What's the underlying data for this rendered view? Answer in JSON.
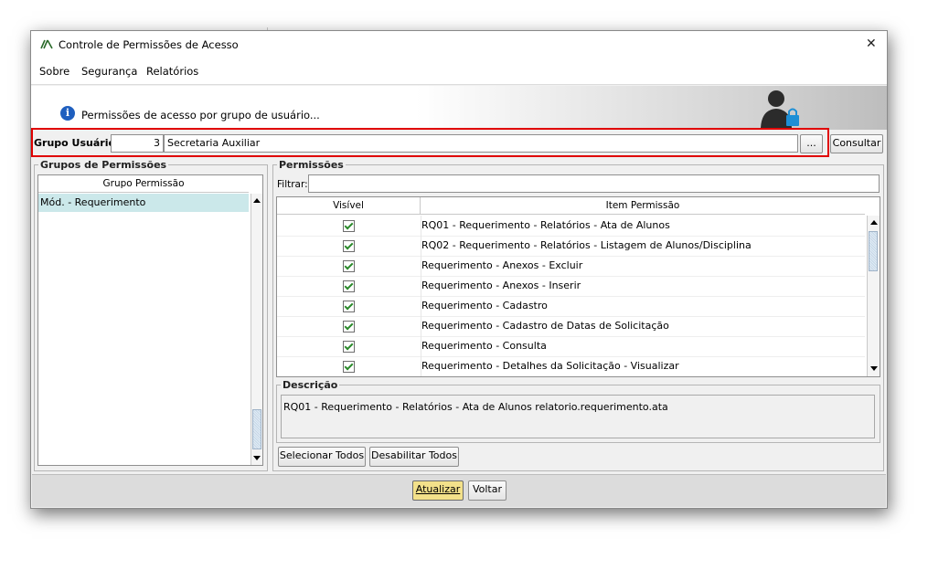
{
  "window": {
    "title": "Controle de Permissões de Acesso",
    "close_label": "✕"
  },
  "menu": {
    "items": [
      "Sobre",
      "Segurança",
      "Relatórios"
    ]
  },
  "header": {
    "info_text": "Permissões de acesso por grupo de usuário..."
  },
  "grupo_usuario": {
    "label": "Grupo Usuário:",
    "code": "3",
    "name": "Secretaria Auxiliar",
    "browse_label": "...",
    "consultar_label": "Consultar",
    "highlight_color": "#e00000"
  },
  "grupos": {
    "legend": "Grupos de Permissões",
    "column_header": "Grupo Permissão",
    "items": [
      "Mód. - Requerimento"
    ],
    "selected_color": "#cbe8ea"
  },
  "permissoes": {
    "legend": "Permissões",
    "filter_label": "Filtrar:",
    "filter_value": "",
    "columns": [
      "Visível",
      "Item Permissão"
    ],
    "rows": [
      {
        "visible": true,
        "item": "RQ01 - Requerimento - Relatórios - Ata de Alunos"
      },
      {
        "visible": true,
        "item": "RQ02 - Requerimento - Relatórios - Listagem de Alunos/Disciplina"
      },
      {
        "visible": true,
        "item": "Requerimento - Anexos - Excluir"
      },
      {
        "visible": true,
        "item": "Requerimento - Anexos - Inserir"
      },
      {
        "visible": true,
        "item": "Requerimento - Cadastro"
      },
      {
        "visible": true,
        "item": "Requerimento - Cadastro de Datas de Solicitação"
      },
      {
        "visible": true,
        "item": "Requerimento - Consulta"
      },
      {
        "visible": true,
        "item": "Requerimento - Detalhes da Solicitação - Visualizar"
      }
    ]
  },
  "descricao": {
    "legend": "Descrição",
    "text": "RQ01 - Requerimento - Relatórios - Ata de Alunos relatorio.requerimento.ata"
  },
  "buttons": {
    "select_all": "Selecionar Todos",
    "disable_all": "Desabilitar Todos",
    "atualizar": "Atualizar",
    "voltar": "Voltar"
  }
}
